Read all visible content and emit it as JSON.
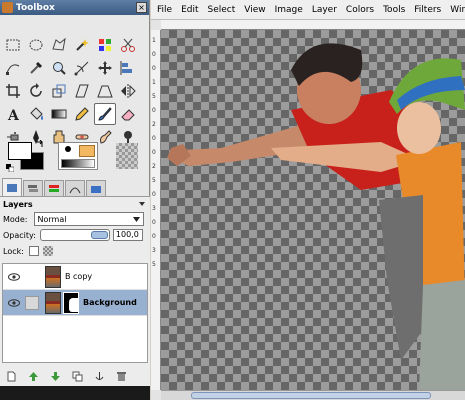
{
  "toolbox": {
    "title": "Toolbox",
    "tools": [
      "rect-select-icon",
      "ellipse-select-icon",
      "free-select-icon",
      "fuzzy-select-icon",
      "color-select-icon",
      "scissors-icon",
      "paths-icon",
      "color-picker-icon",
      "zoom-icon",
      "measure-icon",
      "move-icon",
      "align-icon",
      "crop-icon",
      "rotate-icon",
      "scale-icon",
      "shear-icon",
      "perspective-icon",
      "flip-icon",
      "text-icon",
      "bucket-fill-icon",
      "blend-icon",
      "pencil-icon",
      "paintbrush-icon",
      "eraser-icon",
      "airbrush-icon",
      "ink-icon",
      "clone-icon",
      "heal-icon",
      "smudge-icon",
      "dodge-burn-icon"
    ],
    "active_tool_index": 22
  },
  "layers": {
    "header": "Layers",
    "mode_label": "Mode:",
    "mode_value": "Normal",
    "opacity_label": "Opacity:",
    "opacity_value": "100,0",
    "opacity_fraction": 1.0,
    "lock_label": "Lock:",
    "items": [
      {
        "name": "B copy",
        "selected": false
      },
      {
        "name": "Background",
        "selected": true
      }
    ]
  },
  "menubar": {
    "items": [
      "File",
      "Edit",
      "Select",
      "View",
      "Image",
      "Layer",
      "Colors",
      "Tools",
      "Filters",
      "Windo"
    ]
  },
  "rulers": {
    "vertical": [
      "1",
      "0",
      "0",
      "1",
      "5",
      "0",
      "2",
      "0",
      "0",
      "2",
      "5",
      "0",
      "3",
      "0",
      "0",
      "3",
      "5"
    ]
  },
  "colors": {
    "foreground": "#ffffff",
    "background": "#000000",
    "title_bar": "#4a6a94",
    "selection": "#99b1d0"
  }
}
